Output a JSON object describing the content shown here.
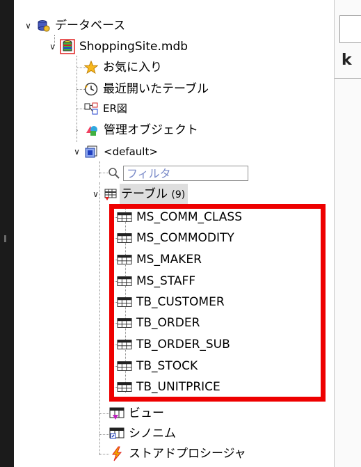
{
  "tree": {
    "database_root": "データベース",
    "db_file": "ShoppingSite.mdb",
    "favorites": "お気に入り",
    "recent_tables": "最近開いたテーブル",
    "er_diagram": "ER図",
    "mgmt_objects": "管理オブジェクト",
    "schema": "<default>",
    "filter_placeholder": "フィルタ",
    "tables_label": "テーブル",
    "tables_count": "(9)",
    "tables": [
      "MS_COMM_CLASS",
      "MS_COMMODITY",
      "MS_MAKER",
      "MS_STAFF",
      "TB_CUSTOMER",
      "TB_ORDER",
      "TB_ORDER_SUB",
      "TB_STOCK",
      "TB_UNITPRICE"
    ],
    "views": "ビュー",
    "synonyms": "シノニム",
    "stored_procs": "ストアドプロシージャ"
  },
  "colors": {
    "highlight_border": "#ee0000",
    "selection_bg": "#dedede"
  }
}
